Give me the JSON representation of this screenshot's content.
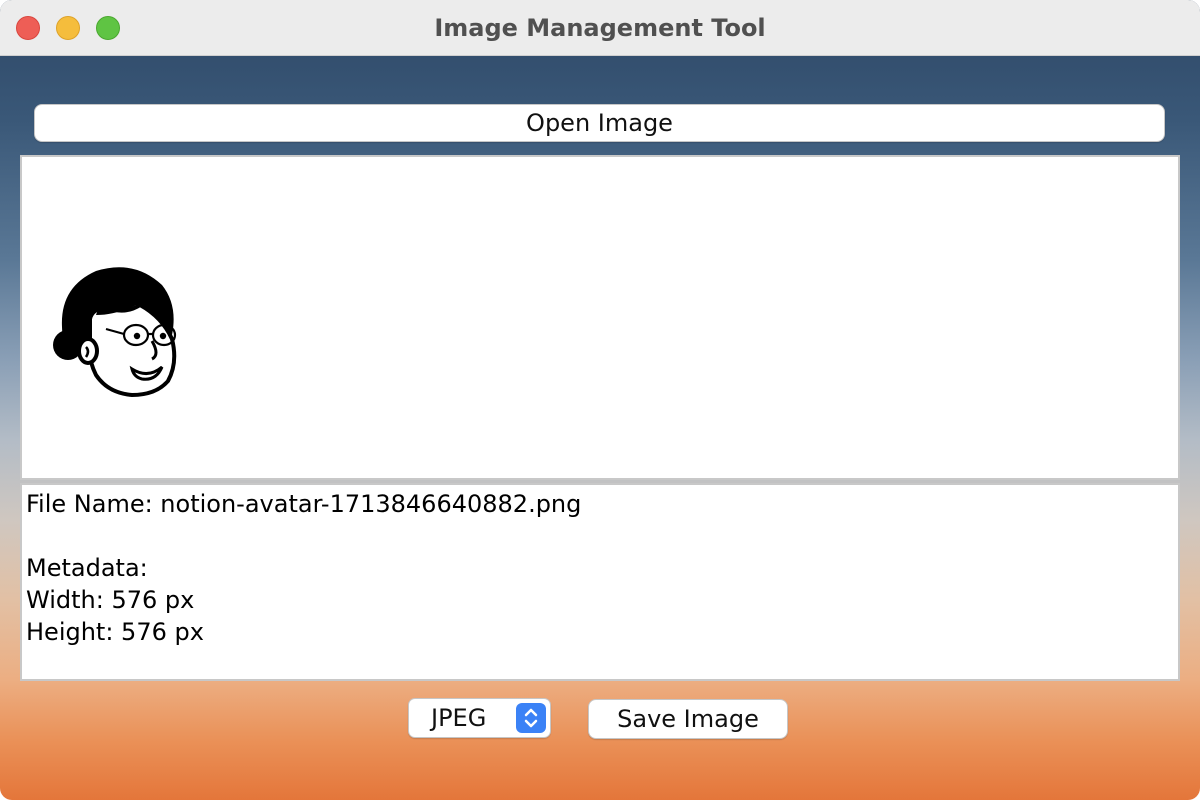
{
  "window": {
    "title": "Image Management Tool"
  },
  "toolbar": {
    "open_label": "Open Image"
  },
  "image_preview": {
    "content": "avatar-illustration"
  },
  "metadata": {
    "file_name_line": "File Name: notion-avatar-1713846640882.png",
    "blank_line": "",
    "header_line": "Metadata:",
    "width_line": "Width: 576 px",
    "height_line": "Height: 576 px"
  },
  "footer": {
    "format_selected": "JPEG",
    "save_label": "Save Image"
  },
  "colors": {
    "accent": "#3b82f6",
    "close": "#ee5e56",
    "minimize": "#f5bd3c",
    "maximize": "#5fc443"
  }
}
